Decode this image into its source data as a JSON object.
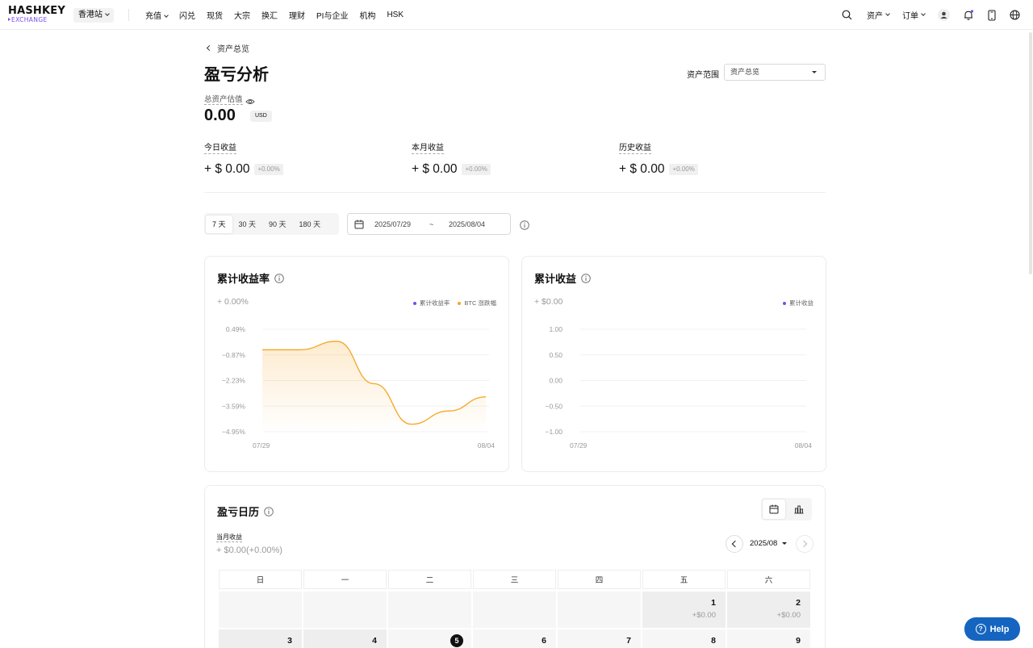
{
  "header": {
    "logo_top": "HASHKEY",
    "logo_bottom": "EXCHANGE",
    "site": "香港站",
    "nav": [
      {
        "label": "充值",
        "dropdown": true
      },
      {
        "label": "闪兑",
        "dropdown": false
      },
      {
        "label": "现货",
        "dropdown": false
      },
      {
        "label": "大宗",
        "dropdown": false
      },
      {
        "label": "换汇",
        "dropdown": false
      },
      {
        "label": "理财",
        "dropdown": false
      },
      {
        "label": "PI与企业",
        "dropdown": false
      },
      {
        "label": "机构",
        "dropdown": false
      },
      {
        "label": "HSK",
        "dropdown": false
      }
    ],
    "right": {
      "assets": "资产",
      "orders": "订单"
    },
    "icons": [
      "search-icon",
      "user-icon",
      "bell-icon",
      "mobile-icon",
      "globe-icon"
    ]
  },
  "page": {
    "back": "资产总览",
    "title": "盈亏分析",
    "range_label": "资产范围",
    "range_value": "资产总览",
    "total_label": "总资产估值",
    "total_value": "0.00",
    "currency": "USD"
  },
  "stats": [
    {
      "label": "今日收益",
      "amount": "+ $ 0.00",
      "pct": "+0.00%"
    },
    {
      "label": "本月收益",
      "amount": "+ $ 0.00",
      "pct": "+0.00%"
    },
    {
      "label": "历史收益",
      "amount": "+ $ 0.00",
      "pct": "+0.00%"
    }
  ],
  "filters": {
    "periods": [
      "7 天",
      "30 天",
      "90 天",
      "180 天"
    ],
    "active_period": 0,
    "start_date": "2025/07/29",
    "separator": "~",
    "end_date": "2025/08/04"
  },
  "colors": {
    "accent": "#7a4cf0",
    "btc": "#f5a623",
    "help": "#1565c0"
  },
  "chart_data": [
    {
      "type": "line",
      "title": "累计收益率",
      "subtitle": "+ 0.00%",
      "legend": [
        "累计收益率",
        "BTC 涨跌幅"
      ],
      "legend_placement": "top-right",
      "x_ticks": [
        "07/29",
        "08/04"
      ],
      "y_ticks": [
        "0.49%",
        "−0.87%",
        "−2.23%",
        "−3.59%",
        "−4.95%"
      ],
      "ylim": [
        -4.95,
        0.49
      ],
      "grid": true,
      "series": [
        {
          "name": "累计收益率",
          "color": "#7a4cf0",
          "x": [
            "07/29",
            "07/30",
            "07/31",
            "08/01",
            "08/02",
            "08/03",
            "08/04"
          ],
          "y": [
            0,
            0,
            0,
            0,
            0,
            0,
            0
          ]
        },
        {
          "name": "BTC 涨跌幅",
          "color": "#f5a623",
          "x": [
            "07/29",
            "07/30",
            "07/31",
            "08/01",
            "08/02",
            "08/03",
            "08/04"
          ],
          "y": [
            -0.6,
            -0.6,
            -0.15,
            -2.4,
            -4.55,
            -3.85,
            -3.1
          ]
        }
      ]
    },
    {
      "type": "line",
      "title": "累计收益",
      "subtitle": "+ $0.00",
      "legend": [
        "累计收益"
      ],
      "legend_placement": "top-right",
      "x_ticks": [
        "07/29",
        "08/04"
      ],
      "y_ticks": [
        "1.00",
        "0.50",
        "0.00",
        "−0.50",
        "−1.00"
      ],
      "ylim": [
        -1,
        1
      ],
      "grid": true,
      "series": [
        {
          "name": "累计收益",
          "color": "#7a4cf0",
          "x": [
            "07/29",
            "08/04"
          ],
          "y": [
            0,
            0
          ]
        }
      ]
    }
  ],
  "calendar": {
    "title": "盈亏日历",
    "month_label": "当月收益",
    "month_value": "+ $0.00(+0.00%)",
    "month": "2025/08",
    "weekdays": [
      "日",
      "一",
      "二",
      "三",
      "四",
      "五",
      "六"
    ],
    "row1": [
      {
        "day": "",
        "value": ""
      },
      {
        "day": "",
        "value": ""
      },
      {
        "day": "",
        "value": ""
      },
      {
        "day": "",
        "value": ""
      },
      {
        "day": "",
        "value": ""
      },
      {
        "day": "1",
        "value": "+$0.00"
      },
      {
        "day": "2",
        "value": "+$0.00"
      }
    ],
    "row2": [
      {
        "day": "3",
        "value": ""
      },
      {
        "day": "4",
        "value": ""
      },
      {
        "day": "5",
        "value": "",
        "today": true
      },
      {
        "day": "6",
        "value": ""
      },
      {
        "day": "7",
        "value": ""
      },
      {
        "day": "8",
        "value": ""
      },
      {
        "day": "9",
        "value": ""
      }
    ]
  },
  "help": "Help"
}
